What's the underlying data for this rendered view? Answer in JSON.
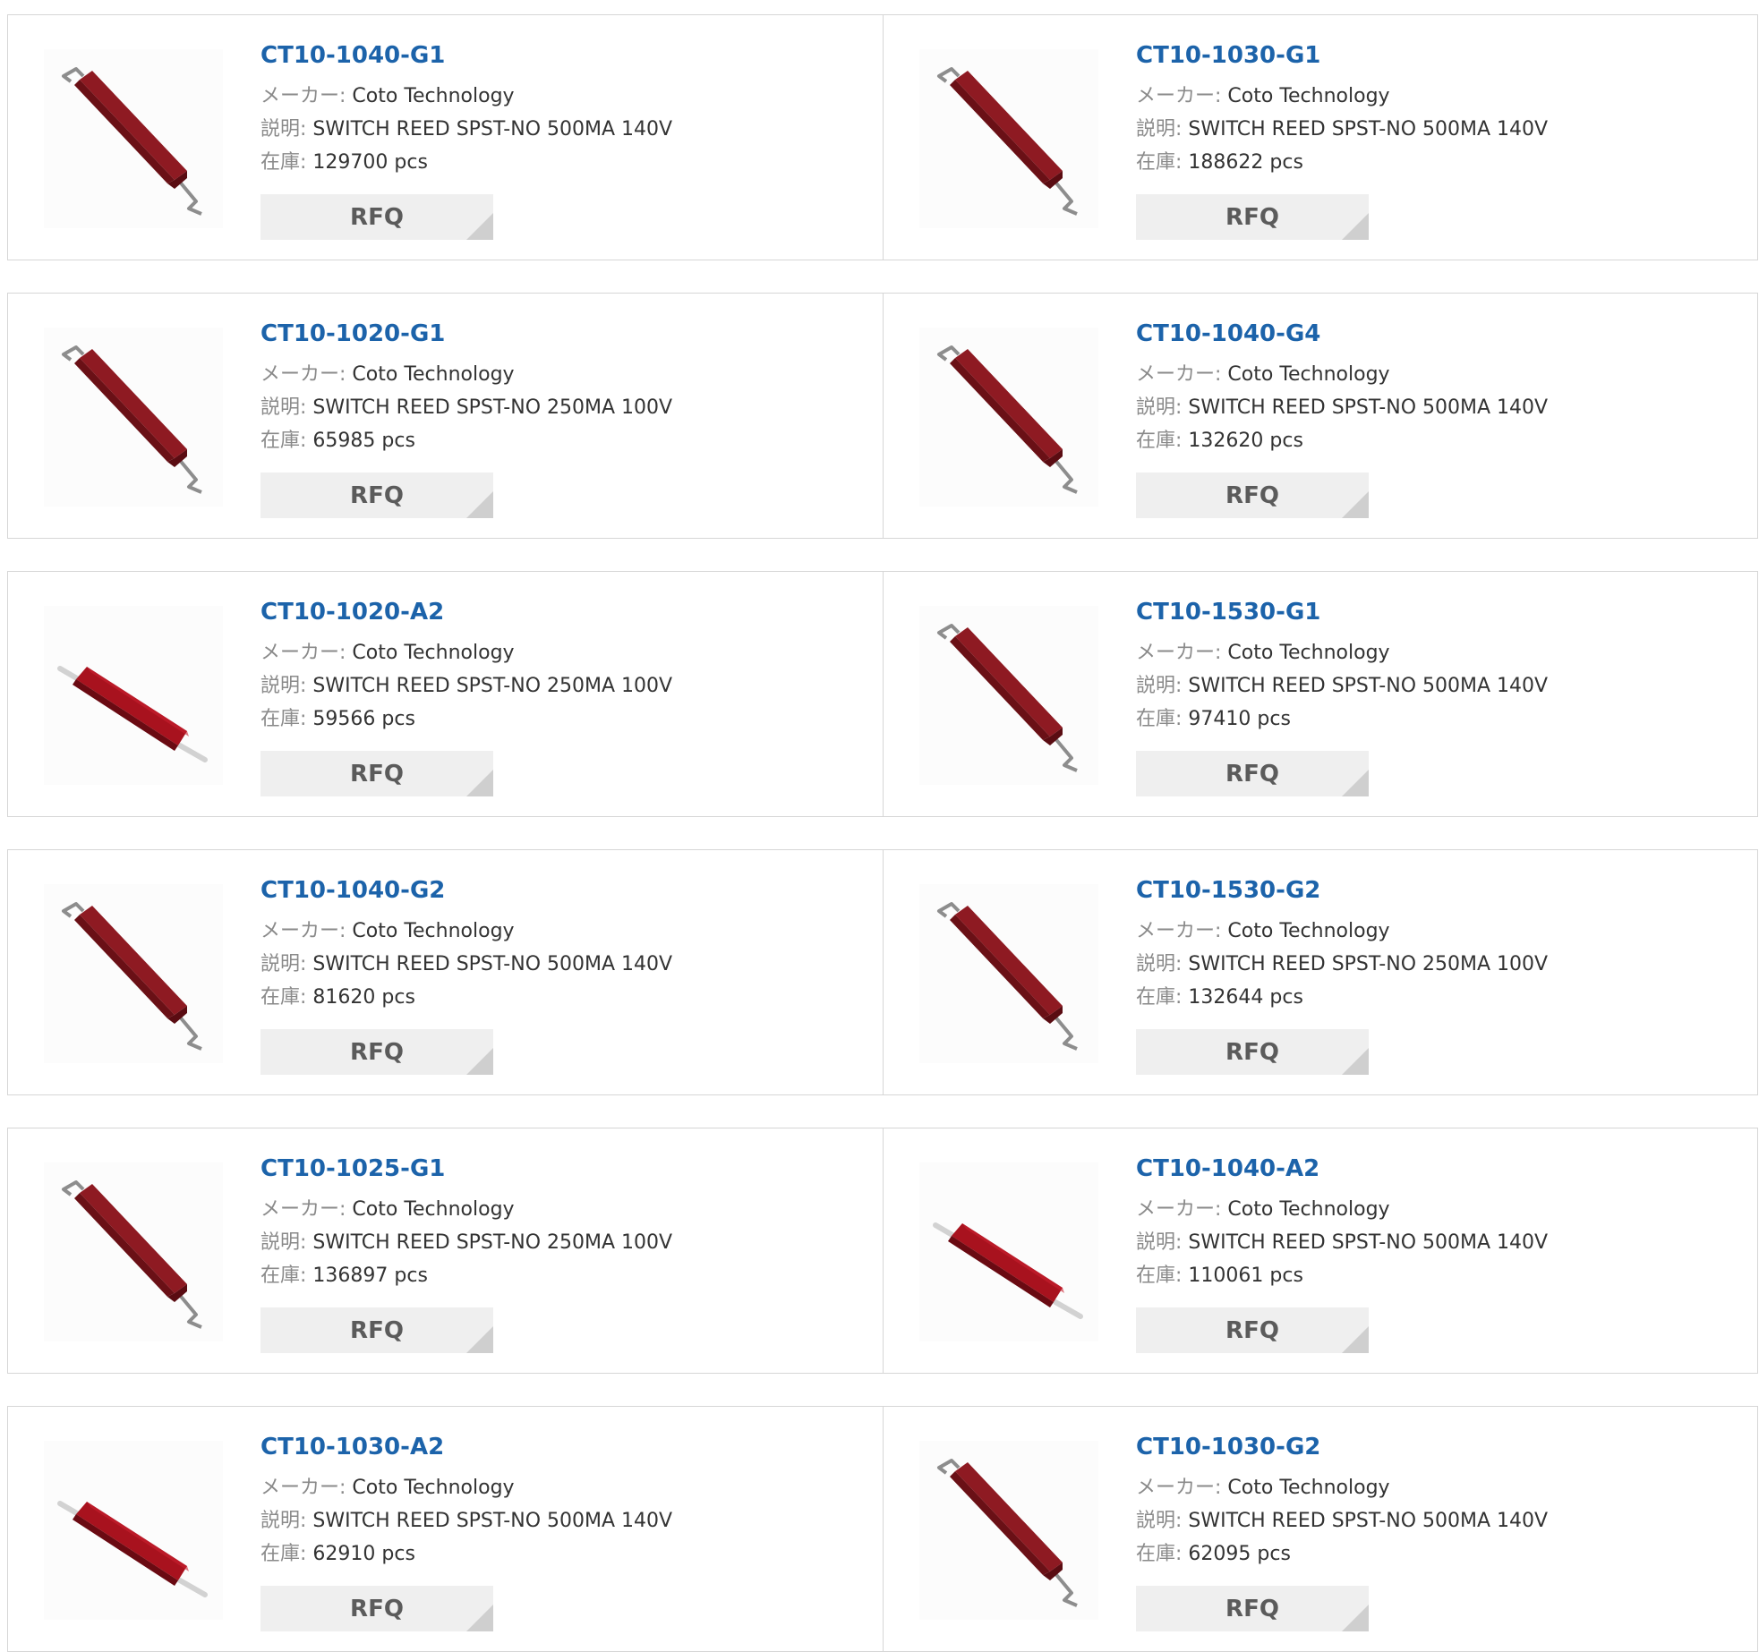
{
  "labels": {
    "maker": "メーカー:",
    "desc": "説明:",
    "stock": "在庫:",
    "rfq": "RFQ"
  },
  "products": [
    {
      "part": "CT10-1040-G1",
      "maker": "Coto Technology",
      "desc": "SWITCH REED SPST-NO 500MA 140V",
      "stock": "129700 pcs",
      "image": "bent-lead-reed-switch"
    },
    {
      "part": "CT10-1030-G1",
      "maker": "Coto Technology",
      "desc": "SWITCH REED SPST-NO 500MA 140V",
      "stock": "188622 pcs",
      "image": "bent-lead-reed-switch"
    },
    {
      "part": "CT10-1020-G1",
      "maker": "Coto Technology",
      "desc": "SWITCH REED SPST-NO 250MA 100V",
      "stock": "65985 pcs",
      "image": "bent-lead-reed-switch"
    },
    {
      "part": "CT10-1040-G4",
      "maker": "Coto Technology",
      "desc": "SWITCH REED SPST-NO 500MA 140V",
      "stock": "132620 pcs",
      "image": "bent-lead-reed-switch"
    },
    {
      "part": "CT10-1020-A2",
      "maker": "Coto Technology",
      "desc": "SWITCH REED SPST-NO 250MA 100V",
      "stock": "59566 pcs",
      "image": "axial-reed-switch"
    },
    {
      "part": "CT10-1530-G1",
      "maker": "Coto Technology",
      "desc": "SWITCH REED SPST-NO 500MA 140V",
      "stock": "97410 pcs",
      "image": "bent-lead-reed-switch"
    },
    {
      "part": "CT10-1040-G2",
      "maker": "Coto Technology",
      "desc": "SWITCH REED SPST-NO 500MA 140V",
      "stock": "81620 pcs",
      "image": "bent-lead-reed-switch"
    },
    {
      "part": "CT10-1530-G2",
      "maker": "Coto Technology",
      "desc": "SWITCH REED SPST-NO 250MA 100V",
      "stock": "132644 pcs",
      "image": "bent-lead-reed-switch"
    },
    {
      "part": "CT10-1025-G1",
      "maker": "Coto Technology",
      "desc": "SWITCH REED SPST-NO 250MA 100V",
      "stock": "136897 pcs",
      "image": "bent-lead-reed-switch"
    },
    {
      "part": "CT10-1040-A2",
      "maker": "Coto Technology",
      "desc": "SWITCH REED SPST-NO 500MA 140V",
      "stock": "110061 pcs",
      "image": "axial-reed-switch"
    },
    {
      "part": "CT10-1030-A2",
      "maker": "Coto Technology",
      "desc": "SWITCH REED SPST-NO 500MA 140V",
      "stock": "62910 pcs",
      "image": "axial-reed-switch"
    },
    {
      "part": "CT10-1030-G2",
      "maker": "Coto Technology",
      "desc": "SWITCH REED SPST-NO 500MA 140V",
      "stock": "62095 pcs",
      "image": "bent-lead-reed-switch"
    }
  ]
}
